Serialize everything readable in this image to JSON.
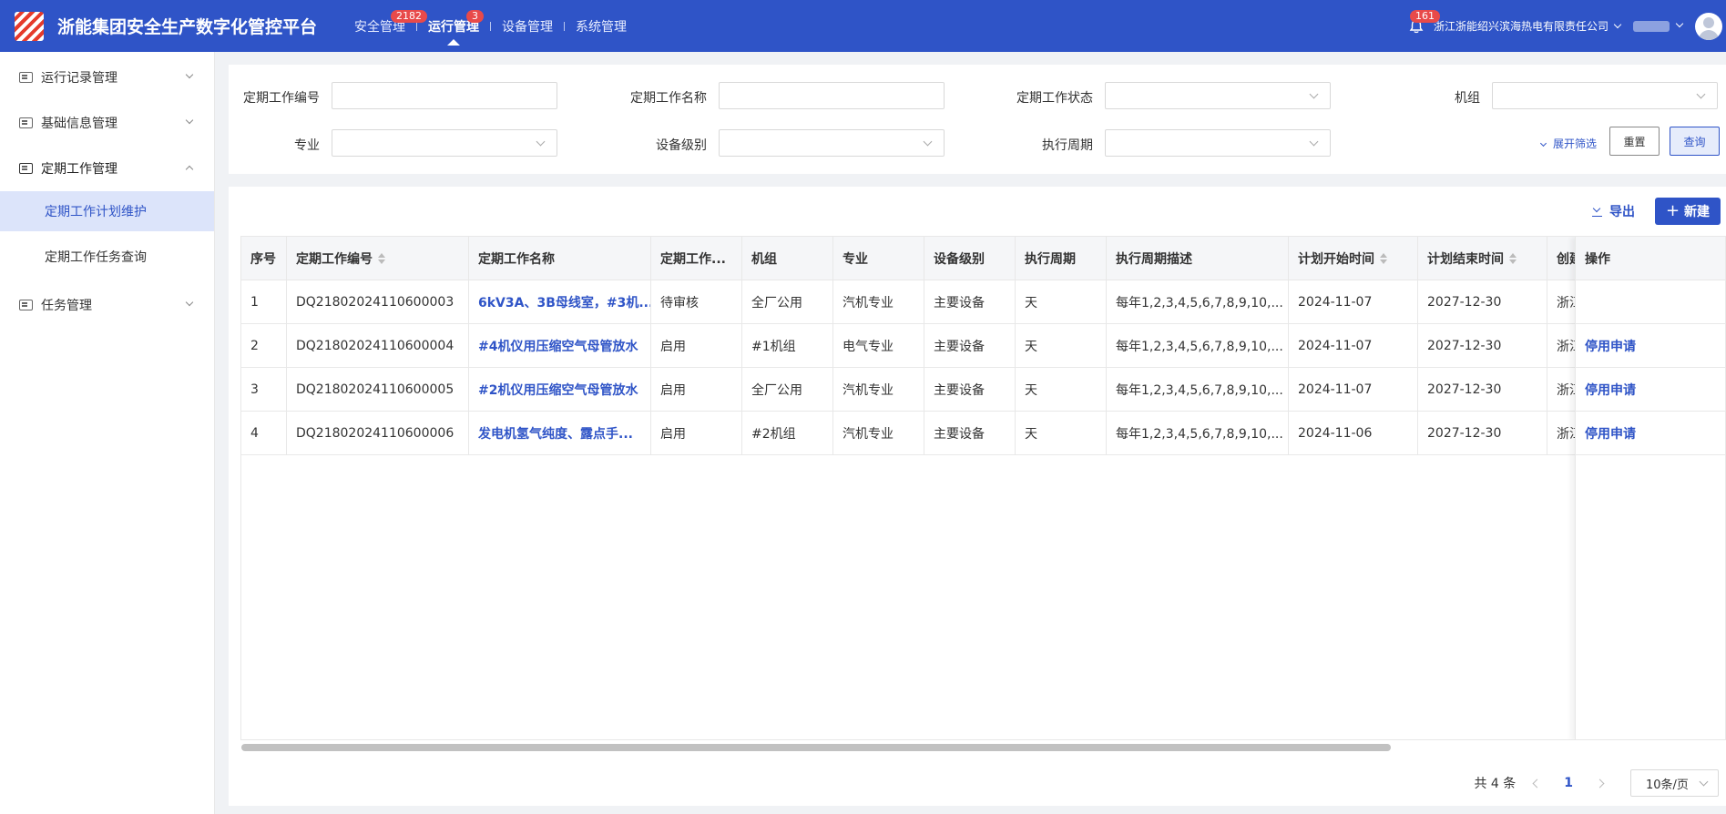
{
  "header": {
    "title": "浙能集团安全生产数字化管控平台",
    "nav": [
      {
        "label": "安全管理",
        "badge": "2182",
        "active": false
      },
      {
        "label": "运行管理",
        "badge": "3",
        "active": true
      },
      {
        "label": "设备管理",
        "badge": "",
        "active": false
      },
      {
        "label": "系统管理",
        "badge": "",
        "active": false
      }
    ],
    "notification_count": "161",
    "company": "浙江浙能绍兴滨海热电有限责任公司"
  },
  "sidebar": {
    "items": [
      {
        "label": "运行记录管理",
        "expanded": false
      },
      {
        "label": "基础信息管理",
        "expanded": false
      },
      {
        "label": "定期工作管理",
        "expanded": true
      },
      {
        "label": "任务管理",
        "expanded": false
      }
    ],
    "subitems": [
      {
        "label": "定期工作计划维护",
        "active": true
      },
      {
        "label": "定期工作任务查询",
        "active": false
      }
    ]
  },
  "filters": {
    "work_no": {
      "label": "定期工作编号",
      "value": ""
    },
    "work_name": {
      "label": "定期工作名称",
      "value": ""
    },
    "work_status": {
      "label": "定期工作状态",
      "value": ""
    },
    "unit": {
      "label": "机组",
      "value": ""
    },
    "specialty": {
      "label": "专业",
      "value": ""
    },
    "device_level": {
      "label": "设备级别",
      "value": ""
    },
    "cycle": {
      "label": "执行周期",
      "value": ""
    },
    "expand_label": "展开筛选",
    "reset_label": "重置",
    "query_label": "查询"
  },
  "toolbar": {
    "export_label": "导出",
    "new_label": "新建"
  },
  "table": {
    "columns": [
      "序号",
      "定期工作编号",
      "定期工作名称",
      "定期工作...",
      "机组",
      "专业",
      "设备级别",
      "执行周期",
      "执行周期描述",
      "计划开始时间",
      "计划结束时间",
      "创建"
    ],
    "op_column": "操作",
    "rows": [
      {
        "index": "1",
        "no": "DQ21802024110600003",
        "name": "6kV3A、3B母线室，#3机...",
        "status": "待审核",
        "unit": "全厂公用",
        "specialty": "汽机专业",
        "level": "主要设备",
        "cycle": "天",
        "cycle_desc": "每年1,2,3,4,5,6,7,8,9,10,...",
        "start": "2024-11-07",
        "end": "2027-12-30",
        "creator": "浙江",
        "op": ""
      },
      {
        "index": "2",
        "no": "DQ21802024110600004",
        "name": "#4机仪用压缩空气母管放水",
        "status": "启用",
        "unit": "#1机组",
        "specialty": "电气专业",
        "level": "主要设备",
        "cycle": "天",
        "cycle_desc": "每年1,2,3,4,5,6,7,8,9,10,...",
        "start": "2024-11-07",
        "end": "2027-12-30",
        "creator": "浙江",
        "op": "停用申请"
      },
      {
        "index": "3",
        "no": "DQ21802024110600005",
        "name": "#2机仪用压缩空气母管放水",
        "status": "启用",
        "unit": "全厂公用",
        "specialty": "汽机专业",
        "level": "主要设备",
        "cycle": "天",
        "cycle_desc": "每年1,2,3,4,5,6,7,8,9,10,...",
        "start": "2024-11-07",
        "end": "2027-12-30",
        "creator": "浙江",
        "op": "停用申请"
      },
      {
        "index": "4",
        "no": "DQ21802024110600006",
        "name": "发电机氢气纯度、露点手...",
        "status": "启用",
        "unit": "#2机组",
        "specialty": "汽机专业",
        "level": "主要设备",
        "cycle": "天",
        "cycle_desc": "每年1,2,3,4,5,6,7,8,9,10,...",
        "start": "2024-11-06",
        "end": "2027-12-30",
        "creator": "浙江",
        "op": "停用申请"
      }
    ]
  },
  "pagination": {
    "total_text": "共 4 条",
    "current_page": "1",
    "page_size": "10条/页"
  }
}
